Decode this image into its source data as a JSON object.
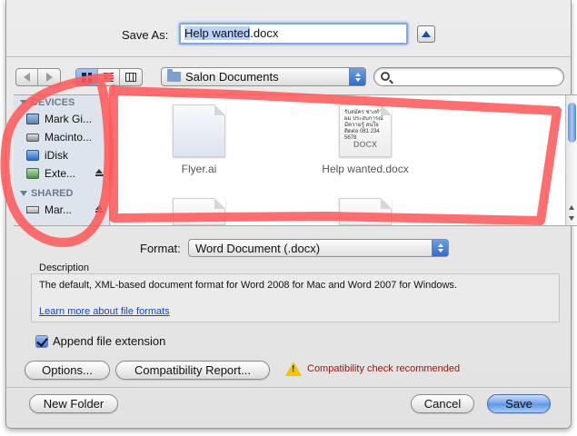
{
  "dialog": {
    "save_as_label": "Save As:",
    "filename_base": "Help wanted",
    "filename_ext": ".docx"
  },
  "toolbar": {
    "location": "Salon Documents",
    "search_placeholder": ""
  },
  "sidebar": {
    "devices_header": "DEVICES",
    "devices": [
      {
        "label": "Mark Gi...",
        "icon": "monitor-icon"
      },
      {
        "label": "Macinto...",
        "icon": "drive-icon"
      },
      {
        "label": "iDisk",
        "icon": "idisk-icon"
      },
      {
        "label": "Exte...",
        "icon": "external-drive-icon",
        "eject": true
      }
    ],
    "shared_header": "SHARED",
    "shared": [
      {
        "label": "Mar...",
        "icon": "network-icon",
        "eject": true
      }
    ]
  },
  "files": [
    {
      "name": "Flyer.ai",
      "icon": "illustrator-file-icon"
    },
    {
      "name": "Help wanted.docx",
      "icon": "docx-file-icon",
      "type_label": "DOCX",
      "preview_text": "รับสมัคร ช่างทำผม ประสบการณ์ มีความรู้ สนใจติดต่อ 081 234 5678"
    }
  ],
  "format": {
    "label": "Format:",
    "selected": "Word Document (.docx)"
  },
  "description": {
    "label": "Description",
    "text": "The default, XML-based document format for Word 2008 for Mac and Word 2007 for Windows.",
    "link": "Learn more about file formats"
  },
  "append_extension": {
    "label": "Append file extension",
    "checked": true
  },
  "buttons": {
    "options": "Options...",
    "compat_report": "Compatibility Report...",
    "new_folder": "New Folder",
    "cancel": "Cancel",
    "save": "Save"
  },
  "warning": {
    "text": "Compatibility check recommended"
  },
  "colors": {
    "accent": "#5a95e8",
    "warning_text": "#8a1a12",
    "annotation": "#ff5a5a"
  }
}
